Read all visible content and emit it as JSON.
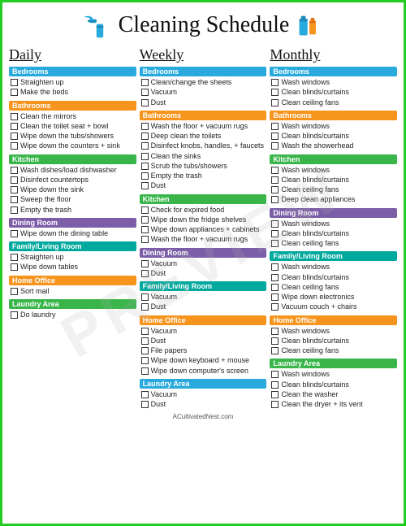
{
  "title": "Cleaning Schedule",
  "watermark": "PREVIEW",
  "footer": "ACultivatedNest.com",
  "columns": [
    {
      "header": "Daily",
      "sections": [
        {
          "label": "Bedrooms",
          "color": "blue",
          "items": [
            "Straighten up",
            "Make the beds"
          ]
        },
        {
          "label": "Bathrooms",
          "color": "orange",
          "items": [
            "Clean the mirrors",
            "Clean the toilet seat + bowl",
            "Wipe down the tubs/showers",
            "Wipe down the counters + sink"
          ]
        },
        {
          "label": "Kitchen",
          "color": "green",
          "items": [
            "Wash dishes/load dishwasher",
            "Disinfect countertops",
            "Wipe down the sink",
            "Sweep the floor",
            "Empty the trash"
          ]
        },
        {
          "label": "Dining Room",
          "color": "purple",
          "items": [
            "Wipe down the dining table"
          ]
        },
        {
          "label": "Family/Living Room",
          "color": "teal",
          "items": [
            "Straighten up",
            "Wipe down tables"
          ]
        },
        {
          "label": "Home Office",
          "color": "orange",
          "items": [
            "Sort mail"
          ]
        },
        {
          "label": "Laundry Area",
          "color": "green",
          "items": [
            "Do laundry"
          ]
        }
      ]
    },
    {
      "header": "Weekly",
      "sections": [
        {
          "label": "Bedrooms",
          "color": "blue",
          "items": [
            "Clean/change the sheets",
            "Vacuum",
            "Dust"
          ]
        },
        {
          "label": "Bathrooms",
          "color": "orange",
          "items": [
            "Wash the floor + vacuum rugs",
            "Deep clean the toilets",
            "Disinfect knobs, handles, + faucets",
            "Clean the sinks",
            "Scrub the tubs/showers",
            "Empty the trash",
            "Dust"
          ]
        },
        {
          "label": "Kitchen",
          "color": "green",
          "items": [
            "Check for expired food",
            "Wipe down the fridge shelves",
            "Wipe down appliances + cabinets",
            "Wash the floor + vacuum rugs"
          ]
        },
        {
          "label": "Dining Room",
          "color": "purple",
          "items": [
            "Vacuum",
            "Dust"
          ]
        },
        {
          "label": "Family/Living Room",
          "color": "teal",
          "items": [
            "Vacuum",
            "Dust"
          ]
        },
        {
          "label": "Home Office",
          "color": "orange",
          "items": [
            "Vacuum",
            "Dust",
            "File papers",
            "Wipe down keyboard + mouse",
            "Wipe down computer's screen"
          ]
        },
        {
          "label": "Laundry Area",
          "color": "blue",
          "items": [
            "Vacuum",
            "Dust"
          ]
        }
      ]
    },
    {
      "header": "Monthly",
      "sections": [
        {
          "label": "Bedrooms",
          "color": "blue",
          "items": [
            "Wash windows",
            "Clean blinds/curtains",
            "Clean ceiling fans"
          ]
        },
        {
          "label": "Bathrooms",
          "color": "orange",
          "items": [
            "Wash windows",
            "Clean blinds/curtains",
            "Wash the showerhead"
          ]
        },
        {
          "label": "Kitchen",
          "color": "green",
          "items": [
            "Wash windows",
            "Clean blinds/curtains",
            "Clean ceiling fans",
            "Deep clean appliances"
          ]
        },
        {
          "label": "Dining Room",
          "color": "purple",
          "items": [
            "Wash windows",
            "Clean blinds/curtains",
            "Clean ceiling fans"
          ]
        },
        {
          "label": "Family/Living Room",
          "color": "teal",
          "items": [
            "Wash windows",
            "Clean blinds/curtains",
            "Clean ceiling fans",
            "Wipe down electronics",
            "Vacuum couch + chairs"
          ]
        },
        {
          "label": "Home Office",
          "color": "orange",
          "items": [
            "Wash windows",
            "Clean blinds/curtains",
            "Clean ceiling fans"
          ]
        },
        {
          "label": "Laundry Area",
          "color": "green",
          "items": [
            "Wash windows",
            "Clean blinds/curtains",
            "Clean the washer",
            "Clean the dryer + its vent"
          ]
        }
      ]
    }
  ],
  "colorMap": {
    "blue": "label-blue",
    "orange": "label-orange",
    "green": "label-green",
    "purple": "label-purple",
    "teal": "label-teal"
  }
}
